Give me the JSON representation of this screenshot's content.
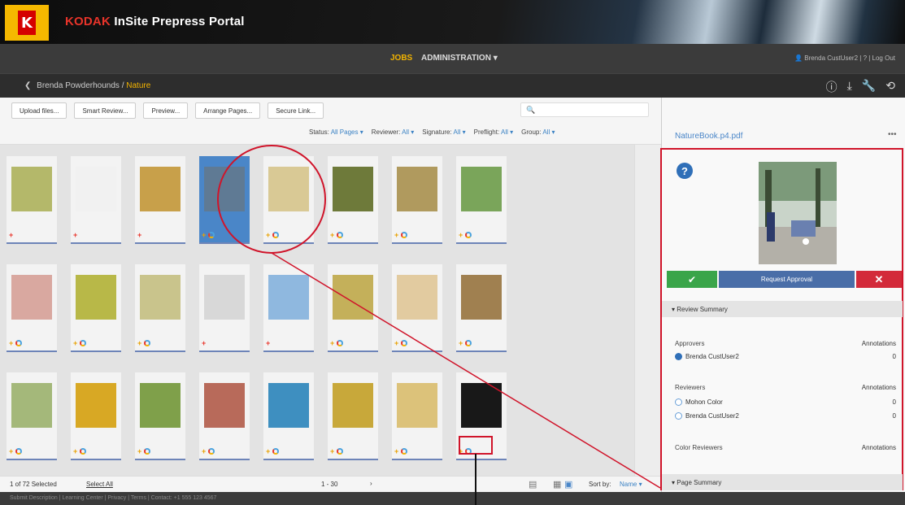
{
  "brand": {
    "kodak": "KODAK",
    "title": " InSite Prepress Portal"
  },
  "nav": {
    "jobs": "JOBS",
    "admin": "ADMINISTRATION ▾",
    "user": "👤 Brenda CustUser2  |  ?  |  Log Out"
  },
  "breadcrumb": {
    "back": "❮",
    "parent": "Brenda Powderhounds",
    "sep": " / ",
    "current": "Nature"
  },
  "toolbar": {
    "buttons": [
      "Upload files...",
      "Smart Review...",
      "Preview...",
      "Arrange Pages...",
      "Secure Link..."
    ],
    "search_placeholder": "🔍"
  },
  "filters": [
    {
      "label": "Status:",
      "value": "All Pages ▾"
    },
    {
      "label": "Reviewer:",
      "value": "All ▾"
    },
    {
      "label": "Signature:",
      "value": "All ▾"
    },
    {
      "label": "Preflight:",
      "value": "All ▾"
    },
    {
      "label": "Group:",
      "value": "All ▾"
    }
  ],
  "grid": {
    "tiles": [
      {
        "thumb": "#b4b86a",
        "marks": "+"
      },
      {
        "thumb": "#f1f1f1",
        "marks": "+"
      },
      {
        "thumb": "#c8a04a",
        "marks": "+"
      },
      {
        "thumb": "#5f7a94",
        "marks": "+O",
        "selected": true
      },
      {
        "thumb": "#d9c995",
        "marks": "+O"
      },
      {
        "thumb": "#6e7a3a",
        "marks": "+O"
      },
      {
        "thumb": "#b09a5e",
        "marks": "+O"
      },
      {
        "thumb": "#7aa55a",
        "marks": "+O"
      },
      {
        "thumb": "#d9a8a0",
        "marks": "+O"
      },
      {
        "thumb": "#b8b848",
        "marks": "+O"
      },
      {
        "thumb": "#c9c48c",
        "marks": "+O"
      },
      {
        "thumb": "#d8d8d8",
        "marks": "+"
      },
      {
        "thumb": "#8fb8df",
        "marks": "+"
      },
      {
        "thumb": "#c4b05a",
        "marks": "+O"
      },
      {
        "thumb": "#e2cba0",
        "marks": "+O"
      },
      {
        "thumb": "#a08050",
        "marks": "+O"
      },
      {
        "thumb": "#a4b87a",
        "marks": "+O"
      },
      {
        "thumb": "#d8a824",
        "marks": "+O"
      },
      {
        "thumb": "#7fa04a",
        "marks": "+O"
      },
      {
        "thumb": "#b86a5a",
        "marks": "+O"
      },
      {
        "thumb": "#3e8fc0",
        "marks": "+O"
      },
      {
        "thumb": "#c8a83a",
        "marks": "+O"
      },
      {
        "thumb": "#dcc27a",
        "marks": "+O"
      },
      {
        "thumb": "#181818",
        "marks": "+O"
      }
    ]
  },
  "bottom": {
    "selected": "1 of 72 Selected",
    "select_all": "Select All",
    "range": "1 - 30",
    "next": "›",
    "sort_label": "Sort by:",
    "sort_value": "Name ▾"
  },
  "footer": {
    "text": "Submit Description  |  Learning Center  |  Privacy  |  Terms  |  Contact: +1 555 123 4567"
  },
  "right": {
    "filename": "NatureBook.p4.pdf",
    "more": "•••",
    "approve_symbol": "✔",
    "request": "Request Approval",
    "reject_symbol": "✕",
    "review_summary": "▾  Review Summary",
    "approvers_header": "Approvers",
    "annotations": "Annotations",
    "approver_name": "Brenda CustUser2",
    "approver_count": "0",
    "reviewers_header": "Reviewers",
    "reviewers": [
      {
        "name": "Mohon Color",
        "count": "0"
      },
      {
        "name": "Brenda CustUser2",
        "count": "0"
      }
    ],
    "color_reviewers": "Color Reviewers",
    "page_summary": "▾  Page Summary"
  }
}
